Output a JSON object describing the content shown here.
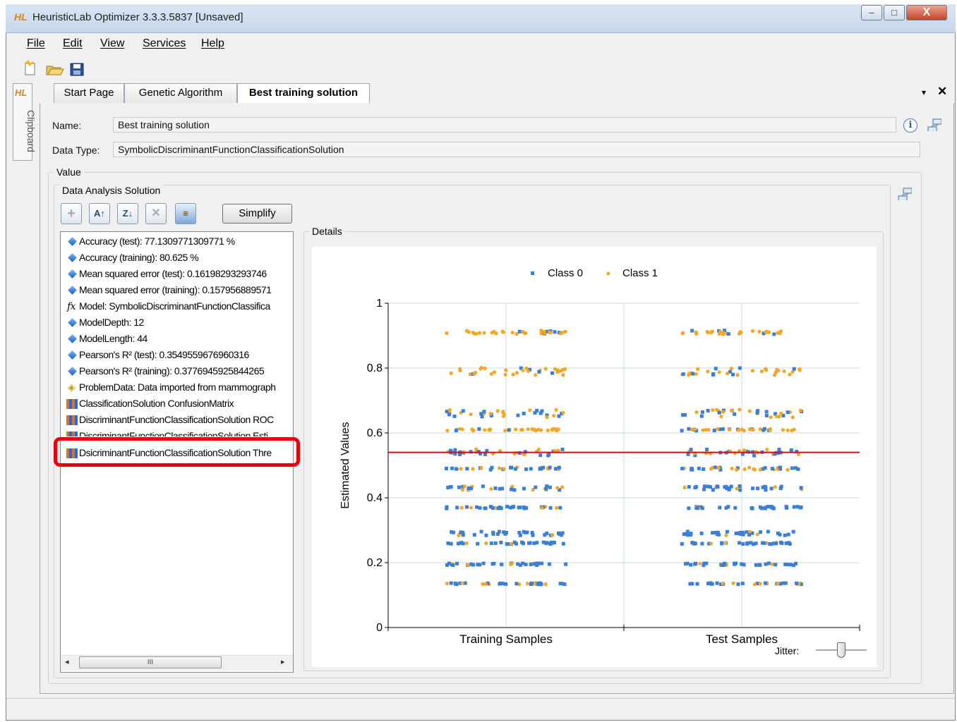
{
  "window": {
    "logo": "HL",
    "title": "HeuristicLab Optimizer 3.3.3.5837 [Unsaved]",
    "close_glyph": "X",
    "minimize_glyph": "–",
    "maximize_glyph": "□"
  },
  "menu": [
    "File",
    "Edit",
    "View",
    "Services",
    "Help"
  ],
  "toolbar": {
    "icons": [
      "new-document-icon",
      "open-folder-icon",
      "save-icon"
    ]
  },
  "clipboard": {
    "logo": "HL",
    "label": "Clipboard"
  },
  "tabs": [
    {
      "label": "Start Page",
      "active": false
    },
    {
      "label": "Genetic Algorithm",
      "active": false
    },
    {
      "label": "Best training solution",
      "active": true
    }
  ],
  "tab_controls": {
    "dropdown": "▾",
    "close": "✕"
  },
  "form": {
    "name_label": "Name:",
    "name_value": "Best training solution",
    "type_label": "Data Type:",
    "type_value": "SymbolicDiscriminantFunctionClassificationSolution",
    "info_glyph": "i"
  },
  "groups": {
    "value": "Value",
    "data_analysis_solution": "Data Analysis Solution",
    "details": "Details"
  },
  "list_toolbar": {
    "add": "+",
    "sort_asc": "A↑",
    "sort_desc": "Z↓",
    "remove": "✕",
    "properties": "≡",
    "simplify_label": "Simplify"
  },
  "results": [
    {
      "icon": "diamond",
      "text": "Accuracy (test): 77.1309771309771 %"
    },
    {
      "icon": "diamond",
      "text": "Accuracy (training): 80.625 %"
    },
    {
      "icon": "diamond",
      "text": "Mean squared error (test): 0.16198293293746"
    },
    {
      "icon": "diamond",
      "text": "Mean squared error (training): 0.157956889571"
    },
    {
      "icon": "fx",
      "text": "Model: SymbolicDiscriminantFunctionClassifica"
    },
    {
      "icon": "diamond",
      "text": "ModelDepth: 12"
    },
    {
      "icon": "diamond",
      "text": "ModelLength: 44"
    },
    {
      "icon": "diamond",
      "text": "Pearson's R² (test): 0.3549559676960316"
    },
    {
      "icon": "diamond",
      "text": "Pearson's R² (training): 0.3776945925844265"
    },
    {
      "icon": "shapes",
      "text": "ProblemData: Data imported from mammograph"
    },
    {
      "icon": "chart",
      "text": "ClassificationSolution ConfusionMatrix"
    },
    {
      "icon": "chart",
      "text": "DiscriminantFunctionClassificationSolution ROC"
    },
    {
      "icon": "chart",
      "text": "DiscriminantFunctionClassificationSolution Esti"
    },
    {
      "icon": "chart",
      "text": "DsicriminantFunctionClassificationSolution Thre"
    }
  ],
  "scrollbar": {
    "left": "◂",
    "right": "▸",
    "thumb": "III"
  },
  "jitter": {
    "label": "Jitter:",
    "value": 0.5
  },
  "colors": {
    "class0": "#3a7fd5",
    "class1": "#f5a623",
    "threshold": "#e8000d",
    "highlight": "#e8000d",
    "grid": "#c9d9ee"
  },
  "chart_data": {
    "type": "scatter",
    "ylabel": "Estimated Values",
    "xlabel": "",
    "categories": [
      "Training Samples",
      "Test Samples"
    ],
    "ylim": [
      0,
      1
    ],
    "yticks": [
      0,
      0.2,
      0.4,
      0.6,
      0.8,
      1
    ],
    "ytick_labels": [
      "0",
      "0.2",
      "0.4",
      "0.6",
      "0.8",
      "1"
    ],
    "legend": {
      "position": "top-center",
      "entries": [
        "Class 0",
        "Class 1"
      ]
    },
    "grid": true,
    "threshold": 0.54,
    "bands": [
      {
        "y": 0.91,
        "class0_share": 0.25,
        "spread": 0.006
      },
      {
        "y": 0.79,
        "class0_share": 0.2,
        "spread": 0.012
      },
      {
        "y": 0.66,
        "class0_share": 0.5,
        "spread": 0.012
      },
      {
        "y": 0.61,
        "class0_share": 0.2,
        "spread": 0.003
      },
      {
        "y": 0.54,
        "class0_share": 0.6,
        "spread": 0.01
      },
      {
        "y": 0.49,
        "class0_share": 0.6,
        "spread": 0.004
      },
      {
        "y": 0.43,
        "class0_share": 0.75,
        "spread": 0.006
      },
      {
        "y": 0.37,
        "class0_share": 0.85,
        "spread": 0.003
      },
      {
        "y": 0.29,
        "class0_share": 0.85,
        "spread": 0.006
      },
      {
        "y": 0.26,
        "class0_share": 0.85,
        "spread": 0.003
      },
      {
        "y": 0.195,
        "class0_share": 0.85,
        "spread": 0.003
      },
      {
        "y": 0.135,
        "class0_share": 0.8,
        "spread": 0.002
      }
    ]
  }
}
